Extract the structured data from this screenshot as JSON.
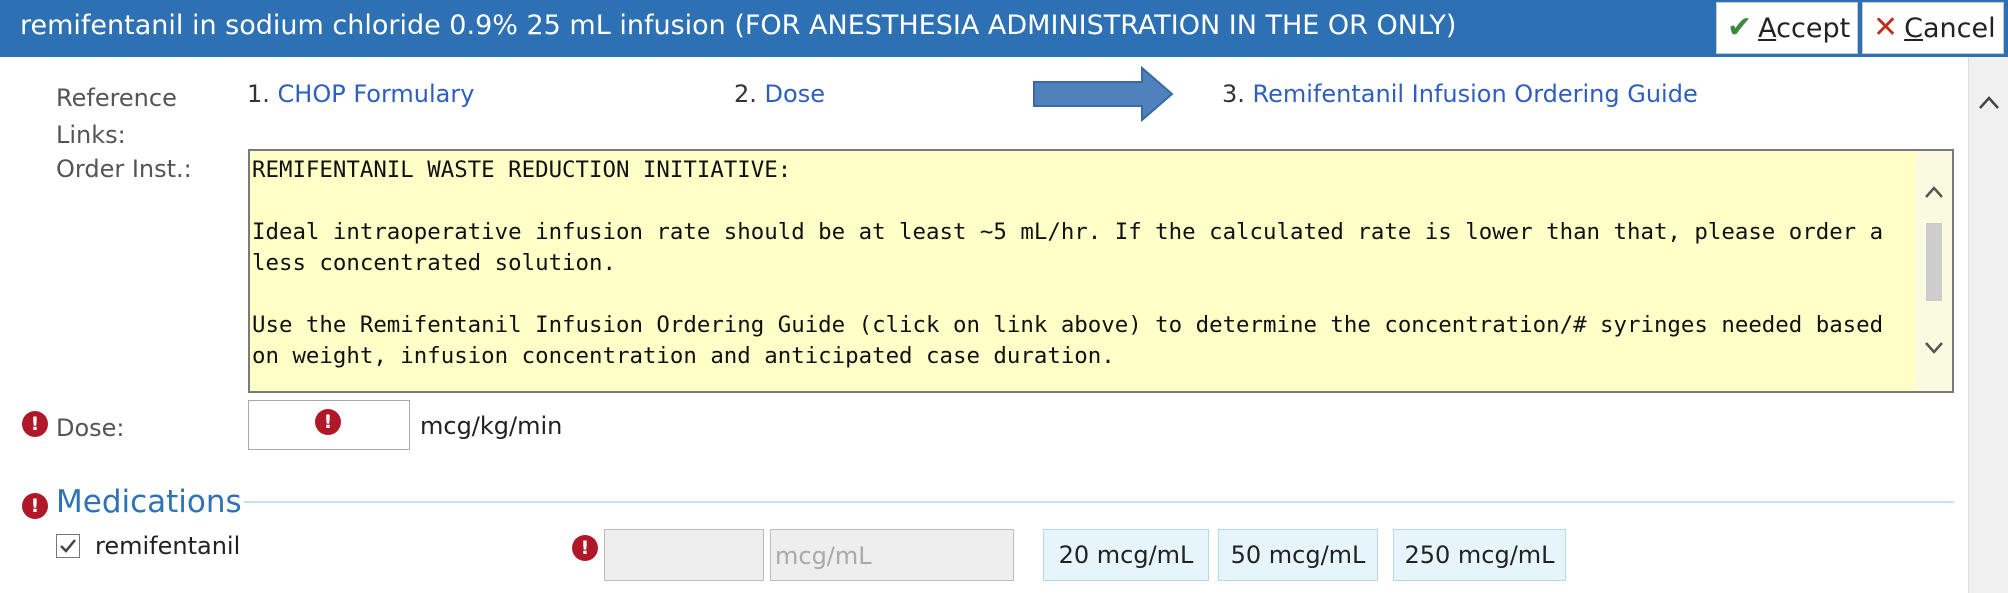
{
  "window": {
    "title": "remifentanil in sodium chloride 0.9% 25 mL infusion (FOR ANESTHESIA ADMINISTRATION IN THE OR ONLY)",
    "accept": {
      "key": "A",
      "rest": "ccept"
    },
    "cancel": {
      "key": "C",
      "rest": "ancel"
    }
  },
  "reference": {
    "label_line1": "Reference",
    "label_line2": "Links:",
    "links": [
      {
        "num": "1. ",
        "text": "CHOP Formulary"
      },
      {
        "num": "2. ",
        "text": "Dose"
      },
      {
        "num": "3. ",
        "text": "Remifentanil Infusion Ordering Guide"
      }
    ]
  },
  "order_inst": {
    "label": "Order Inst.:",
    "text": "REMIFENTANIL WASTE REDUCTION INITIATIVE:\n\nIdeal intraoperative infusion rate should be at least ~5 mL/hr. If the calculated rate is lower than that, please order a less concentrated solution.\n\nUse the Remifentanil Infusion Ordering Guide (click on link above) to determine the concentration/# syringes needed based on weight, infusion concentration and anticipated case duration."
  },
  "dose": {
    "label": "Dose:",
    "value": "",
    "unit": "mcg/kg/min"
  },
  "medications": {
    "heading": "Medications",
    "item_label": "remifentanil",
    "checked": true,
    "concentration_value": "",
    "concentration_placeholder": "mcg/mL",
    "quick_buttons": [
      "20 mcg/mL",
      "50 mcg/mL",
      "250 mcg/mL"
    ]
  },
  "colors": {
    "titlebar": "#2d71b4",
    "link": "#2e5fbf",
    "required": "#b0182a",
    "instructions_bg": "#ffffc8",
    "section_heading": "#2e74b5",
    "accent_arrow": "#4f81bd"
  }
}
